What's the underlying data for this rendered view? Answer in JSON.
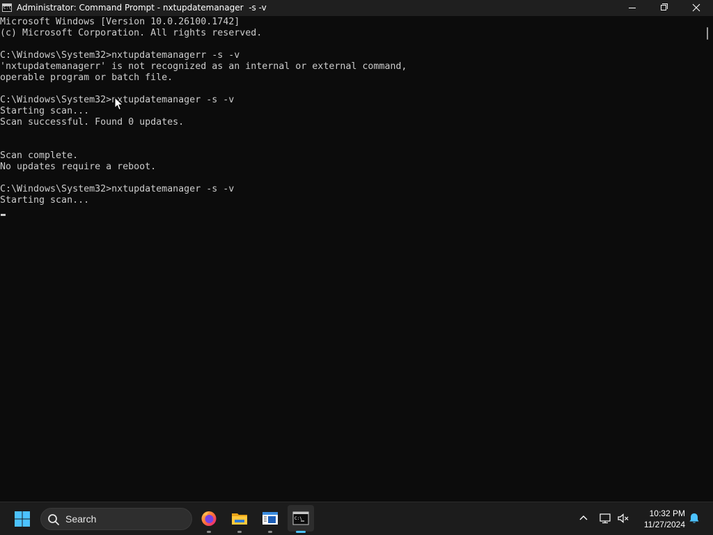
{
  "window": {
    "title": "Administrator: Command Prompt - nxtupdatemanager  -s -v",
    "icon_text": "C:\\"
  },
  "console": {
    "lines": [
      "Microsoft Windows [Version 10.0.26100.1742]",
      "(c) Microsoft Corporation. All rights reserved.",
      "",
      "C:\\Windows\\System32>nxtupdatemanagerr -s -v",
      "'nxtupdatemanagerr' is not recognized as an internal or external command,",
      "operable program or batch file.",
      "",
      "C:\\Windows\\System32>nxtupdatemanager -s -v",
      "Starting scan...",
      "Scan successful. Found 0 updates.",
      "",
      "",
      "Scan complete.",
      "No updates require a reboot.",
      "",
      "C:\\Windows\\System32>nxtupdatemanager -s -v",
      "Starting scan..."
    ]
  },
  "taskbar": {
    "search_placeholder": "Search",
    "apps": [
      "firefox-icon",
      "file-explorer-icon",
      "notepad-icon",
      "terminal-icon"
    ],
    "active_app": "terminal-icon",
    "time": "10:32 PM",
    "date": "11/27/2024"
  },
  "colors": {
    "console_background": "#0c0c0c",
    "console_text": "#cccccc",
    "titlebar": "#1f1f1f",
    "taskbar": "#1c1c1c",
    "accent": "#4cc2ff"
  }
}
